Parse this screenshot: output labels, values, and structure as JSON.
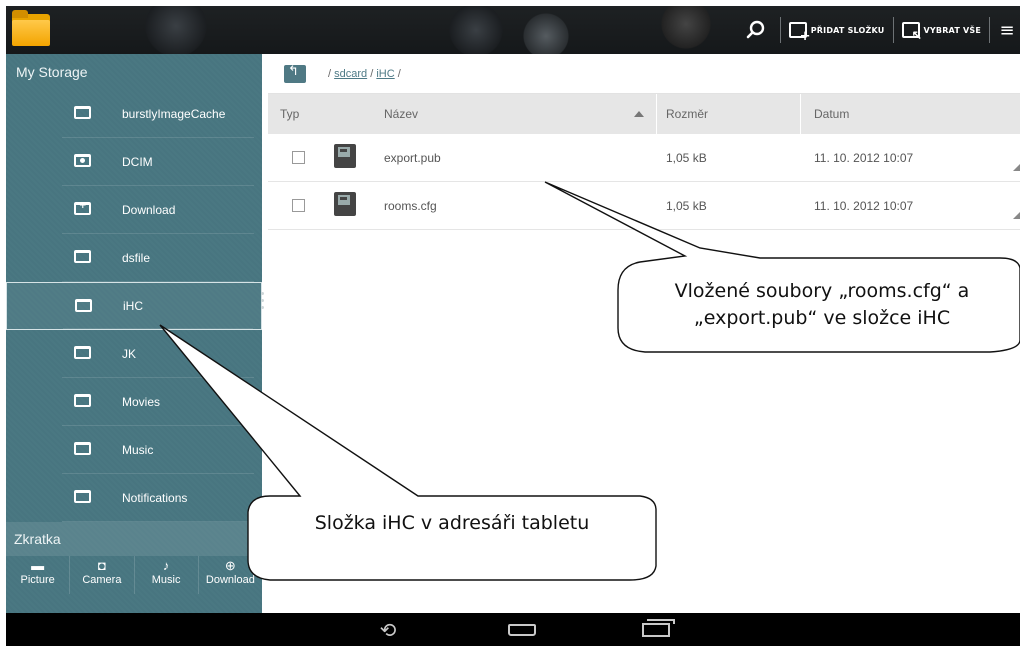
{
  "toolbar": {
    "add_folder_label": "PŘIDAT SLOŽKU",
    "select_all_label": "VYBRAT VŠE",
    "icons": [
      "app-folder-icon",
      "search-icon",
      "add-folder-icon",
      "select-all-icon",
      "menu-icon"
    ]
  },
  "sidebar": {
    "header": "My Storage",
    "items": [
      {
        "label": "burstlyImageCache",
        "icon": "folder-icon"
      },
      {
        "label": "DCIM",
        "icon": "camera-folder-icon"
      },
      {
        "label": "Download",
        "icon": "download-folder-icon"
      },
      {
        "label": "dsfile",
        "icon": "folder-icon"
      },
      {
        "label": "iHC",
        "icon": "folder-icon",
        "selected": true
      },
      {
        "label": "JK",
        "icon": "folder-icon"
      },
      {
        "label": "Movies",
        "icon": "folder-icon"
      },
      {
        "label": "Music",
        "icon": "folder-icon"
      },
      {
        "label": "Notifications",
        "icon": "folder-icon"
      }
    ],
    "shortcuts_header": "Zkratka",
    "shortcuts": [
      {
        "label": "Picture",
        "icon": "picture-icon"
      },
      {
        "label": "Camera",
        "icon": "camera-icon"
      },
      {
        "label": "Music",
        "icon": "music-icon"
      },
      {
        "label": "Download",
        "icon": "download-icon"
      }
    ]
  },
  "path": {
    "sep1": "/",
    "sdcard": "sdcard",
    "sep2": "/",
    "ihc": "iHC",
    "sep3": "/"
  },
  "table": {
    "columns": {
      "type": "Typ",
      "name": "Název",
      "size": "Rozměr",
      "date": "Datum"
    },
    "rows": [
      {
        "name": "export.pub",
        "size": "1,05 kB",
        "date": "11. 10. 2012 10:07"
      },
      {
        "name": "rooms.cfg",
        "size": "1,05 kB",
        "date": "11. 10. 2012 10:07"
      }
    ]
  },
  "annotations": {
    "files_note_line1": "Vložené soubory „rooms.cfg“ a",
    "files_note_line2": "„export.pub“ ve složce iHC",
    "folder_note": "Složka iHC v  adresáři tabletu"
  },
  "colors": {
    "sidebar": "#4a7882",
    "accent": "#4e7a86",
    "header_bg": "#e6e6e6",
    "topbar": "#1b1e21"
  }
}
